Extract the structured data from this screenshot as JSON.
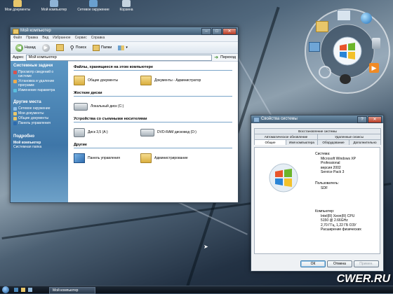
{
  "desktop": {
    "icons": [
      {
        "label": "Мои документы"
      },
      {
        "label": "Мой компьютер"
      },
      {
        "label": "Сетевое окружение"
      },
      {
        "label": "Корзина"
      }
    ]
  },
  "explorer": {
    "title": "Мой компьютер",
    "menu": [
      "Файл",
      "Правка",
      "Вид",
      "Избранное",
      "Сервис",
      "Справка"
    ],
    "toolbar": {
      "back": "Назад",
      "search": "Поиск",
      "folders": "Папки"
    },
    "address_label": "Адрес",
    "address_value": "Мой компьютер",
    "go_label": "Переход",
    "left": {
      "system_tasks": {
        "title": "Системные задачи",
        "items": [
          "Просмотр сведений о системе",
          "Установка и удаление программ",
          "Изменение параметра"
        ]
      },
      "other_places": {
        "title": "Другие места",
        "items": [
          "Сетевое окружение",
          "Мои документы",
          "Общие документы",
          "Панель управления"
        ]
      },
      "details": {
        "title": "Подробно",
        "name": "Мой компьютер",
        "type": "Системная папка"
      }
    },
    "groups": {
      "stored": {
        "title": "Файлы, хранящиеся на этом компьютере",
        "items": [
          "Общие документы",
          "Документы - Администратор"
        ]
      },
      "hdd": {
        "title": "Жесткие диски",
        "items": [
          "Локальный диск (C:)"
        ]
      },
      "removable": {
        "title": "Устройства со съемными носителями",
        "items": [
          "Диск 3,5 (A:)",
          "DVD-RAM дисковод (D:)"
        ]
      },
      "other": {
        "title": "Другие",
        "items": [
          "Панель управления",
          "Администрирование"
        ]
      }
    }
  },
  "sysprops": {
    "title": "Свойства системы",
    "tabs_row1": [
      "Восстановление системы"
    ],
    "tabs_row2": [
      "Автоматическое обновление",
      "Удаленные сеансы"
    ],
    "tabs_row3": [
      "Общие",
      "Имя компьютера",
      "Оборудование",
      "Дополнительно"
    ],
    "system_label": "Система:",
    "system_lines": [
      "Microsoft Windows XP",
      "Professional",
      "версия 2002",
      "Service Pack 3"
    ],
    "user_label": "Пользователь:",
    "user_lines": [
      "SDF"
    ],
    "computer_label": "Компьютер:",
    "computer_lines": [
      "Intel(R) Xeon(R) CPU",
      "5150 @ 2.66GHz",
      "2,70 ГГц, 1,22 ГБ ОЗУ",
      "Расширение физических"
    ],
    "buttons": {
      "ok": "ОК",
      "cancel": "Отмена",
      "apply": "Примен."
    }
  },
  "taskbar": {
    "task_label": "Мой компьютер"
  },
  "watermark": "CWER.RU",
  "colors": {
    "left_pane": "#4a86b8",
    "title_bar": "#4f6c86",
    "folder": "#e8c66a"
  }
}
